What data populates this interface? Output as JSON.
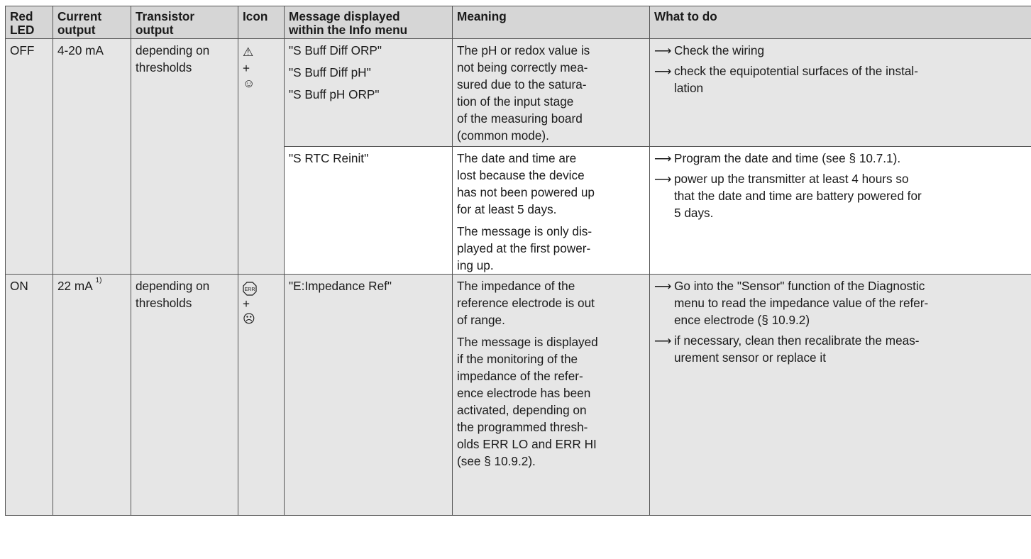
{
  "headers": {
    "red_led": [
      "Red",
      "LED"
    ],
    "current_output": [
      "Current",
      "output"
    ],
    "transistor_output": [
      "Transistor",
      "output"
    ],
    "icon": "Icon",
    "message": [
      "Message displayed",
      "within the Info menu"
    ],
    "meaning": "Meaning",
    "what_to_do": "What to do"
  },
  "row1": {
    "red_led": "OFF",
    "current_output": "4-20 mA",
    "transistor_output": [
      "depending on",
      "thresholds"
    ],
    "icons": [
      "⚠",
      "+",
      "☺"
    ],
    "messages": [
      "\"S Buff Diff ORP\"",
      "\"S Buff Diff pH\"",
      "\"S Buff pH ORP\""
    ],
    "meaning": [
      "The pH or redox value is",
      "not being correctly mea-",
      "sured due to the satura-",
      "tion of the input stage",
      "of the measuring board",
      "(common mode)."
    ],
    "actions": [
      [
        "Check the wiring"
      ],
      [
        "check the equipotential surfaces of the instal-",
        "lation"
      ]
    ]
  },
  "row2": {
    "message": "\"S RTC Reinit\"",
    "meaning_1": [
      "The date and time are",
      "lost because the device",
      "has not been powered up",
      "for at least 5 days."
    ],
    "meaning_2": [
      "The message is only dis-",
      "played at the first power-",
      "ing up."
    ],
    "actions": [
      [
        "Program the date and time (see § 10.7.1)."
      ],
      [
        "power up the transmitter at least 4 hours so",
        "that the date and time are battery powered for",
        "5 days."
      ]
    ]
  },
  "row3": {
    "red_led": "ON",
    "current_output": "22 mA",
    "current_output_note": "1)",
    "transistor_output": [
      "depending on",
      "thresholds"
    ],
    "icons": [
      "ERR",
      "+",
      "☹"
    ],
    "message": "\"E:Impedance Ref\"",
    "meaning_1": [
      "The impedance of the",
      "reference electrode is out",
      "of range."
    ],
    "meaning_2": [
      "The message is displayed",
      "if the monitoring of the",
      "impedance of the refer-",
      "ence electrode has been",
      "activated, depending on",
      "the programmed thresh-",
      "olds ERR LO and ERR HI",
      "(see § 10.9.2)."
    ],
    "actions": [
      [
        "Go into the \"Sensor\" function of the Diagnostic",
        "menu to read the impedance value of the refer-",
        "ence electrode (§ 10.9.2)"
      ],
      [
        "if necessary, clean then recalibrate the meas-",
        "urement sensor or replace it"
      ]
    ]
  },
  "arrow_glyph": "⟶",
  "colors": {
    "header_bg": "#d6d6d6",
    "cell_gray": "#e6e6e6",
    "cell_white": "#ffffff",
    "border": "#555555"
  }
}
